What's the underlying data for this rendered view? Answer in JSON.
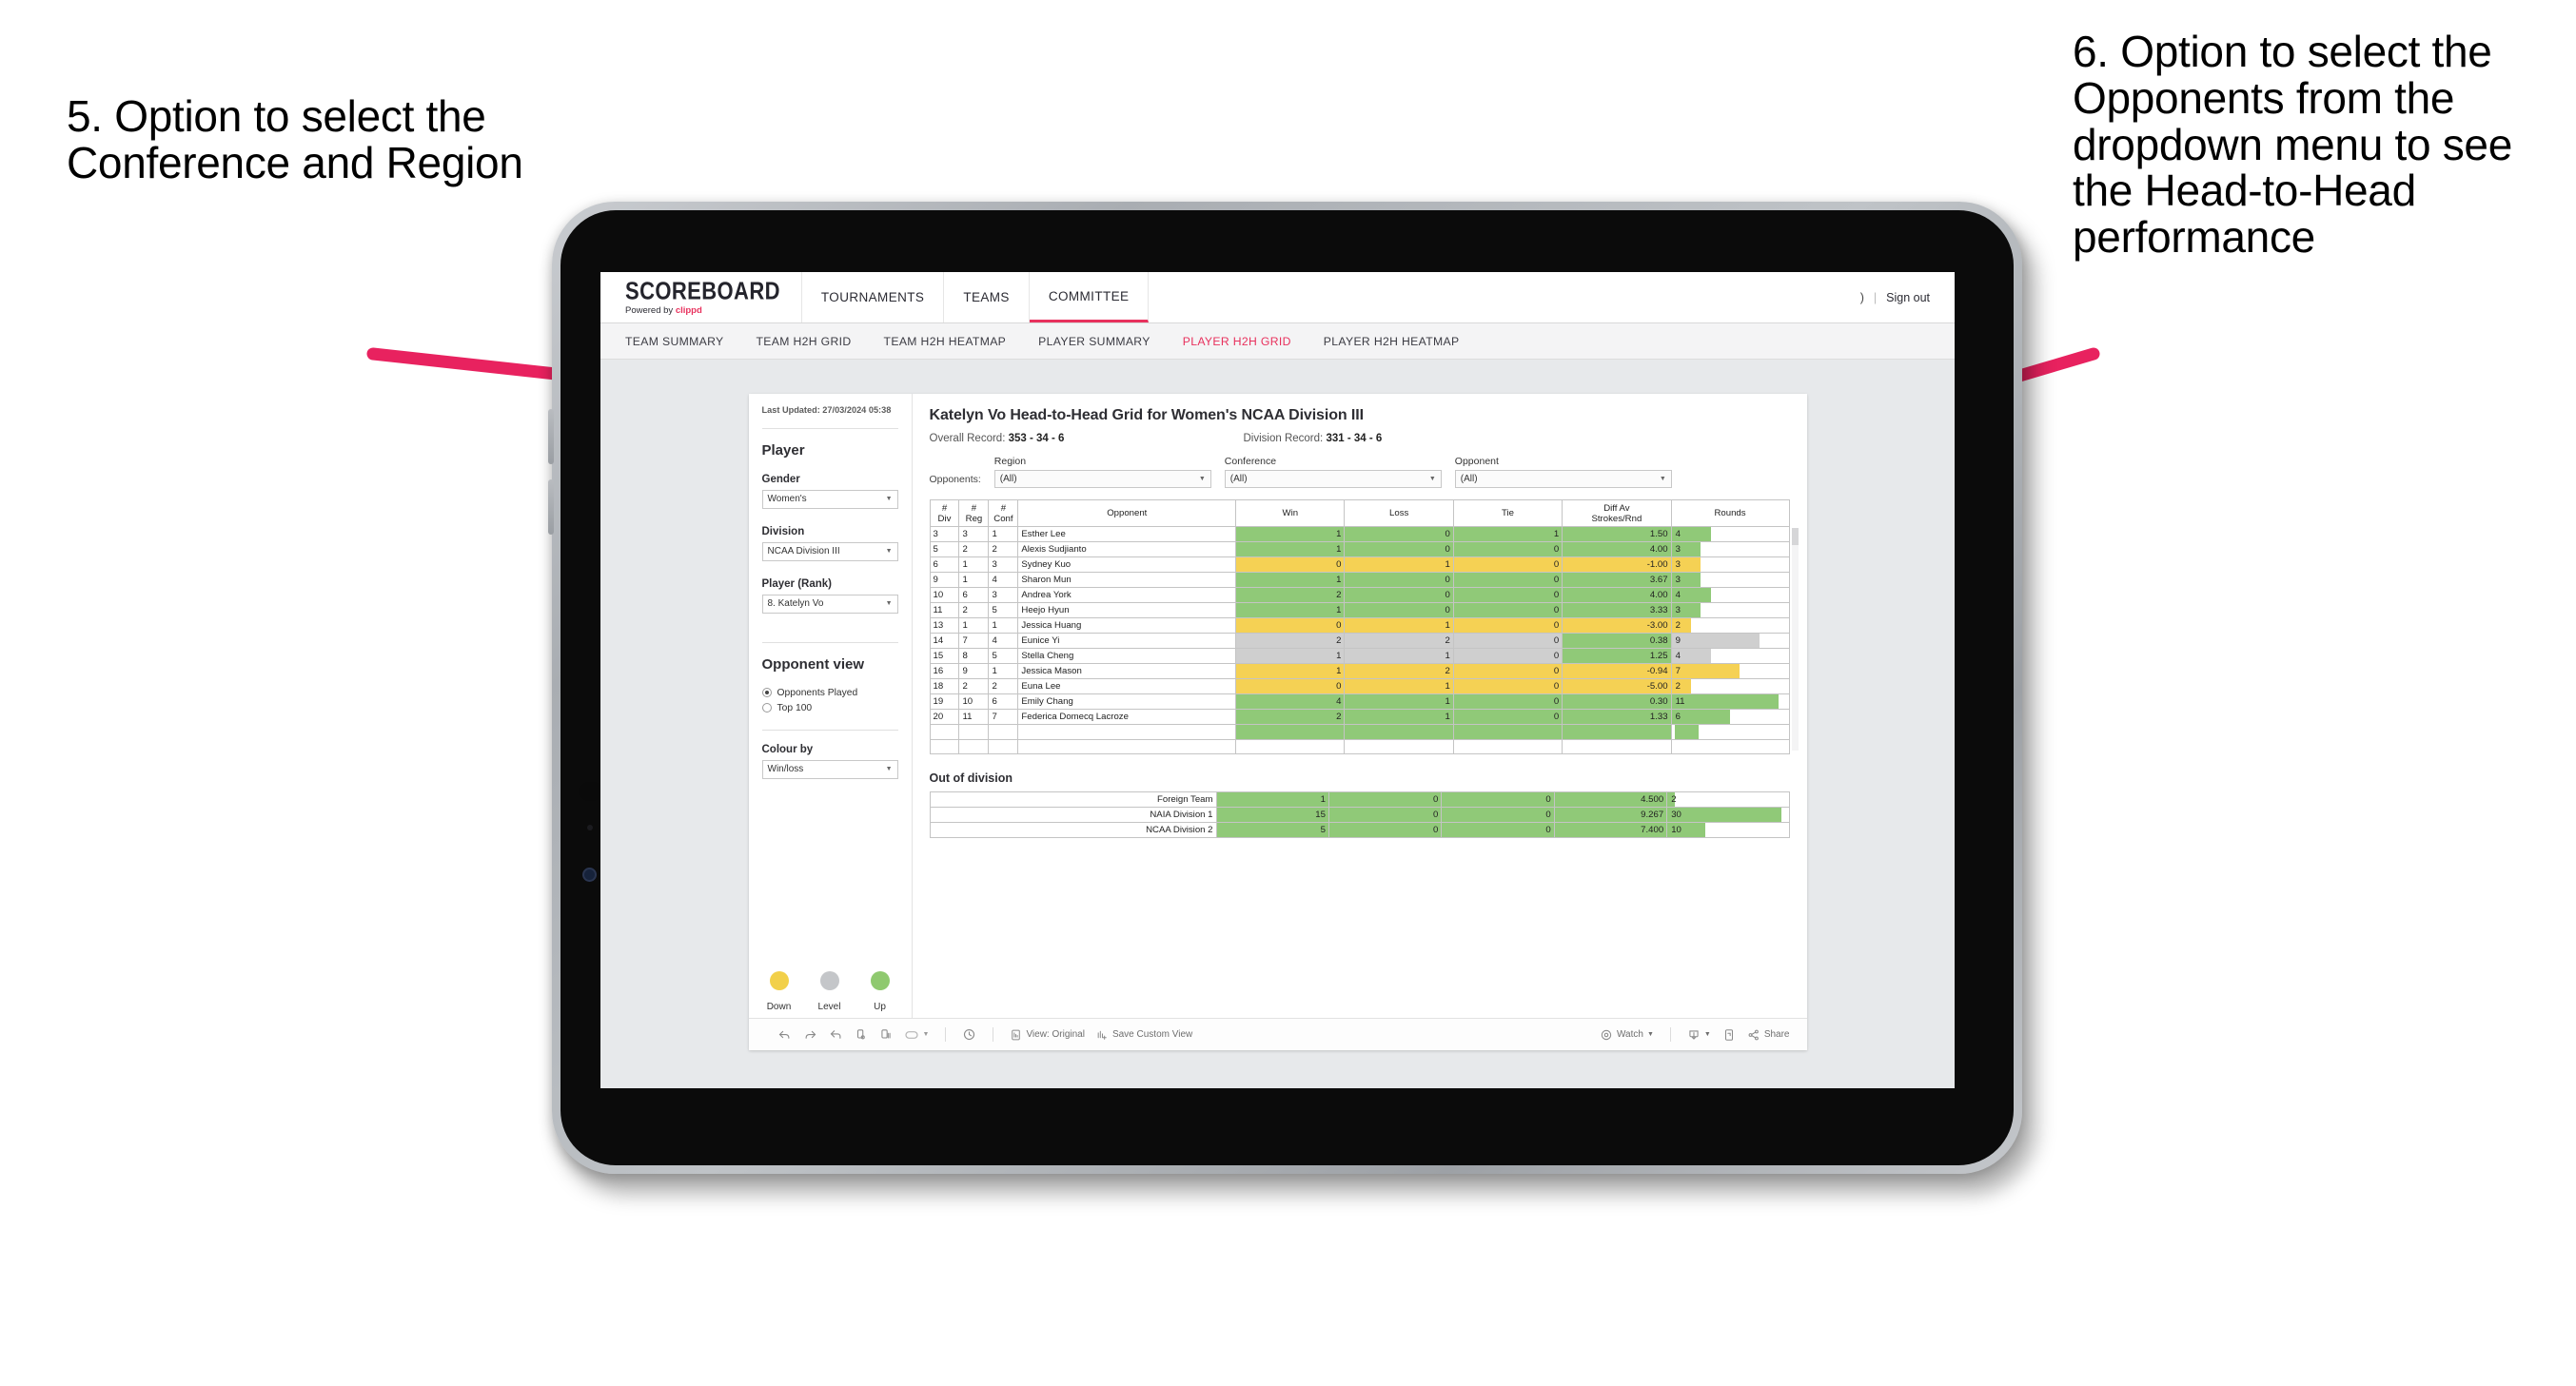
{
  "annotations": {
    "left": "5. Option to select the Conference and Region",
    "right": "6. Option to select the Opponents from the dropdown menu to see the Head-to-Head performance",
    "arrow_color": "#e8225f"
  },
  "appbar": {
    "logo_main": "SCOREBOARD",
    "logo_sub_prefix": "Powered by ",
    "logo_brand": "clippd",
    "nav": [
      {
        "label": "TOURNAMENTS",
        "active": false
      },
      {
        "label": "TEAMS",
        "active": false
      },
      {
        "label": "COMMITTEE",
        "active": true
      }
    ],
    "user_glyph": ")",
    "separator": "|",
    "sign_out": "Sign out"
  },
  "subnav": [
    {
      "label": "TEAM SUMMARY",
      "active": false
    },
    {
      "label": "TEAM H2H GRID",
      "active": false
    },
    {
      "label": "TEAM H2H HEATMAP",
      "active": false
    },
    {
      "label": "PLAYER SUMMARY",
      "active": false
    },
    {
      "label": "PLAYER H2H GRID",
      "active": true
    },
    {
      "label": "PLAYER H2H HEATMAP",
      "active": false
    }
  ],
  "sidebar": {
    "last_updated": "Last Updated: 27/03/2024 05:38",
    "section_player": "Player",
    "gender": {
      "label": "Gender",
      "value": "Women's"
    },
    "division": {
      "label": "Division",
      "value": "NCAA Division III"
    },
    "player_rank": {
      "label": "Player (Rank)",
      "value": "8. Katelyn Vo"
    },
    "opponent_view": {
      "label": "Opponent view",
      "options": [
        {
          "label": "Opponents Played",
          "selected": true
        },
        {
          "label": "Top 100",
          "selected": false
        }
      ]
    },
    "colour_by": {
      "label": "Colour by",
      "value": "Win/loss"
    },
    "legend": [
      {
        "label": "Down",
        "color": "#f2d04a"
      },
      {
        "label": "Level",
        "color": "#c4c6c9"
      },
      {
        "label": "Up",
        "color": "#8fc96f"
      }
    ]
  },
  "viz": {
    "title": "Katelyn Vo Head-to-Head Grid for Women's NCAA Division III",
    "overall_record_label": "Overall Record:",
    "overall_record_value": "353 - 34 - 6",
    "division_record_label": "Division Record:",
    "division_record_value": "331 - 34 - 6",
    "opponents_label": "Opponents:",
    "filters": [
      {
        "label": "Region",
        "value": "(All)"
      },
      {
        "label": "Conference",
        "value": "(All)"
      },
      {
        "label": "Opponent",
        "value": "(All)"
      }
    ]
  },
  "chart_data": {
    "type": "table",
    "title": "Katelyn Vo Head-to-Head Grid for Women's NCAA Division III",
    "columns": [
      "# Div",
      "# Reg",
      "# Conf",
      "Opponent",
      "Win",
      "Loss",
      "Tie",
      "Diff Av Strokes/Rnd",
      "Rounds"
    ],
    "column_header_lines": [
      [
        "#",
        "Div"
      ],
      [
        "#",
        "Reg"
      ],
      [
        "#",
        "Conf"
      ],
      [
        "Opponent"
      ],
      [
        "Win"
      ],
      [
        "Loss"
      ],
      [
        "Tie"
      ],
      [
        "Diff Av",
        "Strokes/Rnd"
      ],
      [
        "Rounds"
      ]
    ],
    "rounds_max": 12,
    "rows": [
      {
        "div": "3",
        "reg": "3",
        "conf": "1",
        "opponent": "Esther Lee",
        "win": "1",
        "loss": "0",
        "tie": "1",
        "diff": "1.50",
        "rounds": "4",
        "rounds_num": 4,
        "status": "up"
      },
      {
        "div": "5",
        "reg": "2",
        "conf": "2",
        "opponent": "Alexis Sudjianto",
        "win": "1",
        "loss": "0",
        "tie": "0",
        "diff": "4.00",
        "rounds": "3",
        "rounds_num": 3,
        "status": "up"
      },
      {
        "div": "6",
        "reg": "1",
        "conf": "3",
        "opponent": "Sydney Kuo",
        "win": "0",
        "loss": "1",
        "tie": "0",
        "diff": "-1.00",
        "rounds": "3",
        "rounds_num": 3,
        "status": "down"
      },
      {
        "div": "9",
        "reg": "1",
        "conf": "4",
        "opponent": "Sharon Mun",
        "win": "1",
        "loss": "0",
        "tie": "0",
        "diff": "3.67",
        "rounds": "3",
        "rounds_num": 3,
        "status": "up"
      },
      {
        "div": "10",
        "reg": "6",
        "conf": "3",
        "opponent": "Andrea York",
        "win": "2",
        "loss": "0",
        "tie": "0",
        "diff": "4.00",
        "rounds": "4",
        "rounds_num": 4,
        "status": "up"
      },
      {
        "div": "11",
        "reg": "2",
        "conf": "5",
        "opponent": "Heejo Hyun",
        "win": "1",
        "loss": "0",
        "tie": "0",
        "diff": "3.33",
        "rounds": "3",
        "rounds_num": 3,
        "status": "up"
      },
      {
        "div": "13",
        "reg": "1",
        "conf": "1",
        "opponent": "Jessica Huang",
        "win": "0",
        "loss": "1",
        "tie": "0",
        "diff": "-3.00",
        "rounds": "2",
        "rounds_num": 2,
        "status": "down"
      },
      {
        "div": "14",
        "reg": "7",
        "conf": "4",
        "opponent": "Eunice Yi",
        "win": "2",
        "loss": "2",
        "tie": "0",
        "diff": "0.38",
        "rounds": "9",
        "rounds_num": 9,
        "status": "level",
        "diff_status": "up"
      },
      {
        "div": "15",
        "reg": "8",
        "conf": "5",
        "opponent": "Stella Cheng",
        "win": "1",
        "loss": "1",
        "tie": "0",
        "diff": "1.25",
        "rounds": "4",
        "rounds_num": 4,
        "status": "level",
        "diff_status": "up"
      },
      {
        "div": "16",
        "reg": "9",
        "conf": "1",
        "opponent": "Jessica Mason",
        "win": "1",
        "loss": "2",
        "tie": "0",
        "diff": "-0.94",
        "rounds": "7",
        "rounds_num": 7,
        "status": "down"
      },
      {
        "div": "18",
        "reg": "2",
        "conf": "2",
        "opponent": "Euna Lee",
        "win": "0",
        "loss": "1",
        "tie": "0",
        "diff": "-5.00",
        "rounds": "2",
        "rounds_num": 2,
        "status": "down"
      },
      {
        "div": "19",
        "reg": "10",
        "conf": "6",
        "opponent": "Emily Chang",
        "win": "4",
        "loss": "1",
        "tie": "0",
        "diff": "0.30",
        "rounds": "11",
        "rounds_num": 11,
        "status": "up"
      },
      {
        "div": "20",
        "reg": "11",
        "conf": "7",
        "opponent": "Federica Domecq Lacroze",
        "win": "2",
        "loss": "1",
        "tie": "0",
        "diff": "1.33",
        "rounds": "6",
        "rounds_num": 6,
        "status": "up"
      }
    ],
    "out_of_division": {
      "title": "Out of division",
      "rounds_max": 32,
      "rows": [
        {
          "label": "Foreign Team",
          "win": "1",
          "loss": "0",
          "tie": "0",
          "diff": "4.500",
          "rounds": "2",
          "rounds_num": 2,
          "status": "up"
        },
        {
          "label": "NAIA Division 1",
          "win": "15",
          "loss": "0",
          "tie": "0",
          "diff": "9.267",
          "rounds": "30",
          "rounds_num": 30,
          "status": "up"
        },
        {
          "label": "NCAA Division 2",
          "win": "5",
          "loss": "0",
          "tie": "0",
          "diff": "7.400",
          "rounds": "10",
          "rounds_num": 10,
          "status": "up"
        }
      ]
    }
  },
  "toolbar": {
    "undo": "undo-icon",
    "redo": "redo-icon",
    "revert": "revert-icon",
    "refresh": "refresh-data-icon",
    "pause": "pause-auto-updates-icon",
    "view_original_label": "View: Original",
    "save_custom_view_label": "Save Custom View",
    "watch_label": "Watch",
    "share_label": "Share"
  }
}
